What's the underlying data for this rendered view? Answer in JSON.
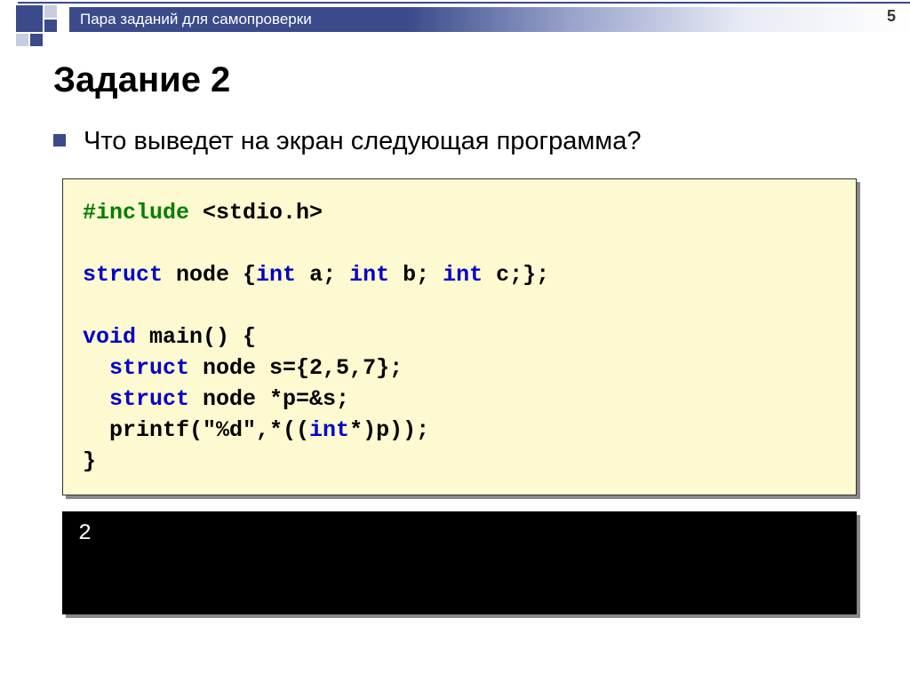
{
  "header": {
    "breadcrumb": "Пара заданий для самопроверки",
    "page_number": "5"
  },
  "title": "Задание 2",
  "question": "Что выведет на экран следующая программа?",
  "code": {
    "line1_kw": "#include",
    "line1_rest": " <stdio.h>",
    "line3_kw": "struct",
    "line3_a": " node {",
    "line3_kw2": "int",
    "line3_b": " a; ",
    "line3_kw3": "int",
    "line3_c": " b; ",
    "line3_kw4": "int",
    "line3_d": " c;};",
    "line5_kw": "void",
    "line5_a": " main() {",
    "line6_kw": "struct",
    "line6_a": " node s={2,5,7};",
    "line7_kw": "struct",
    "line7_a": " node *p=&s;",
    "line8": "  printf(\"%d\",*((",
    "line8_kw": "int",
    "line8_b": "*)p));",
    "line9": "}"
  },
  "output": "2"
}
